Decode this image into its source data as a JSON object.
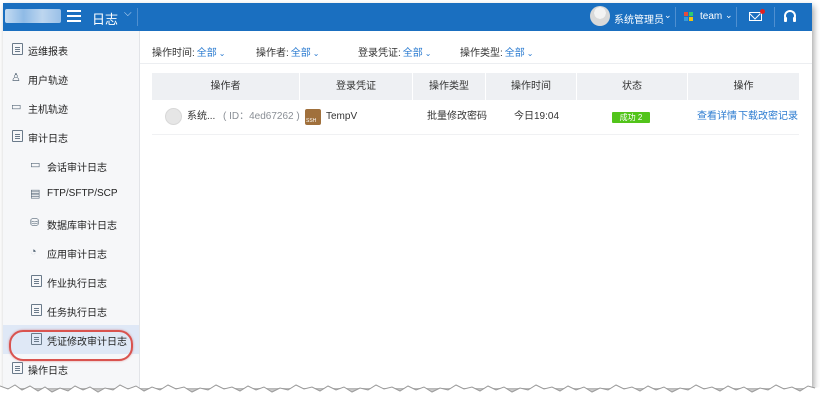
{
  "header": {
    "page_title": "日志",
    "user_name": "系统管理员",
    "team_label": "team"
  },
  "sidebar": {
    "items": [
      {
        "label": "运维报表",
        "icon": "report-icon"
      },
      {
        "label": "用户轨迹",
        "icon": "user-track-icon"
      },
      {
        "label": "主机轨迹",
        "icon": "host-track-icon"
      },
      {
        "label": "审计日志",
        "icon": "audit-log-icon"
      },
      {
        "label": "会话审计日志",
        "icon": "monitor-icon"
      },
      {
        "label": "FTP/SFTP/SCP",
        "icon": "ftp-icon"
      },
      {
        "label": "数据库审计日志",
        "icon": "database-icon"
      },
      {
        "label": "应用审计日志",
        "icon": "app-icon"
      },
      {
        "label": "作业执行日志",
        "icon": "job-icon"
      },
      {
        "label": "任务执行日志",
        "icon": "task-icon"
      },
      {
        "label": "凭证修改审计日志",
        "icon": "credential-log-icon"
      },
      {
        "label": "操作日志",
        "icon": "operation-log-icon"
      }
    ]
  },
  "filters": [
    {
      "label": "操作时间:",
      "value": "全部"
    },
    {
      "label": "操作者:",
      "value": "全部"
    },
    {
      "label": "登录凭证:",
      "value": "全部"
    },
    {
      "label": "操作类型:",
      "value": "全部"
    }
  ],
  "table": {
    "headers": [
      "操作者",
      "登录凭证",
      "操作类型",
      "操作时间",
      "状态",
      "操作"
    ],
    "rows": [
      {
        "operator": "系统...",
        "operator_id": "( ID：4ed67262 )",
        "credential": "TempV",
        "operation_type": "批量修改密码",
        "time": "今日19:04",
        "status": "成功 2",
        "action_view": "查看详情",
        "action_download": "下载改密记录"
      }
    ]
  },
  "colors": {
    "topbar": "#1a6fc0",
    "link": "#2b7bd0",
    "success": "#52c41a",
    "highlight": "#d9534f"
  }
}
